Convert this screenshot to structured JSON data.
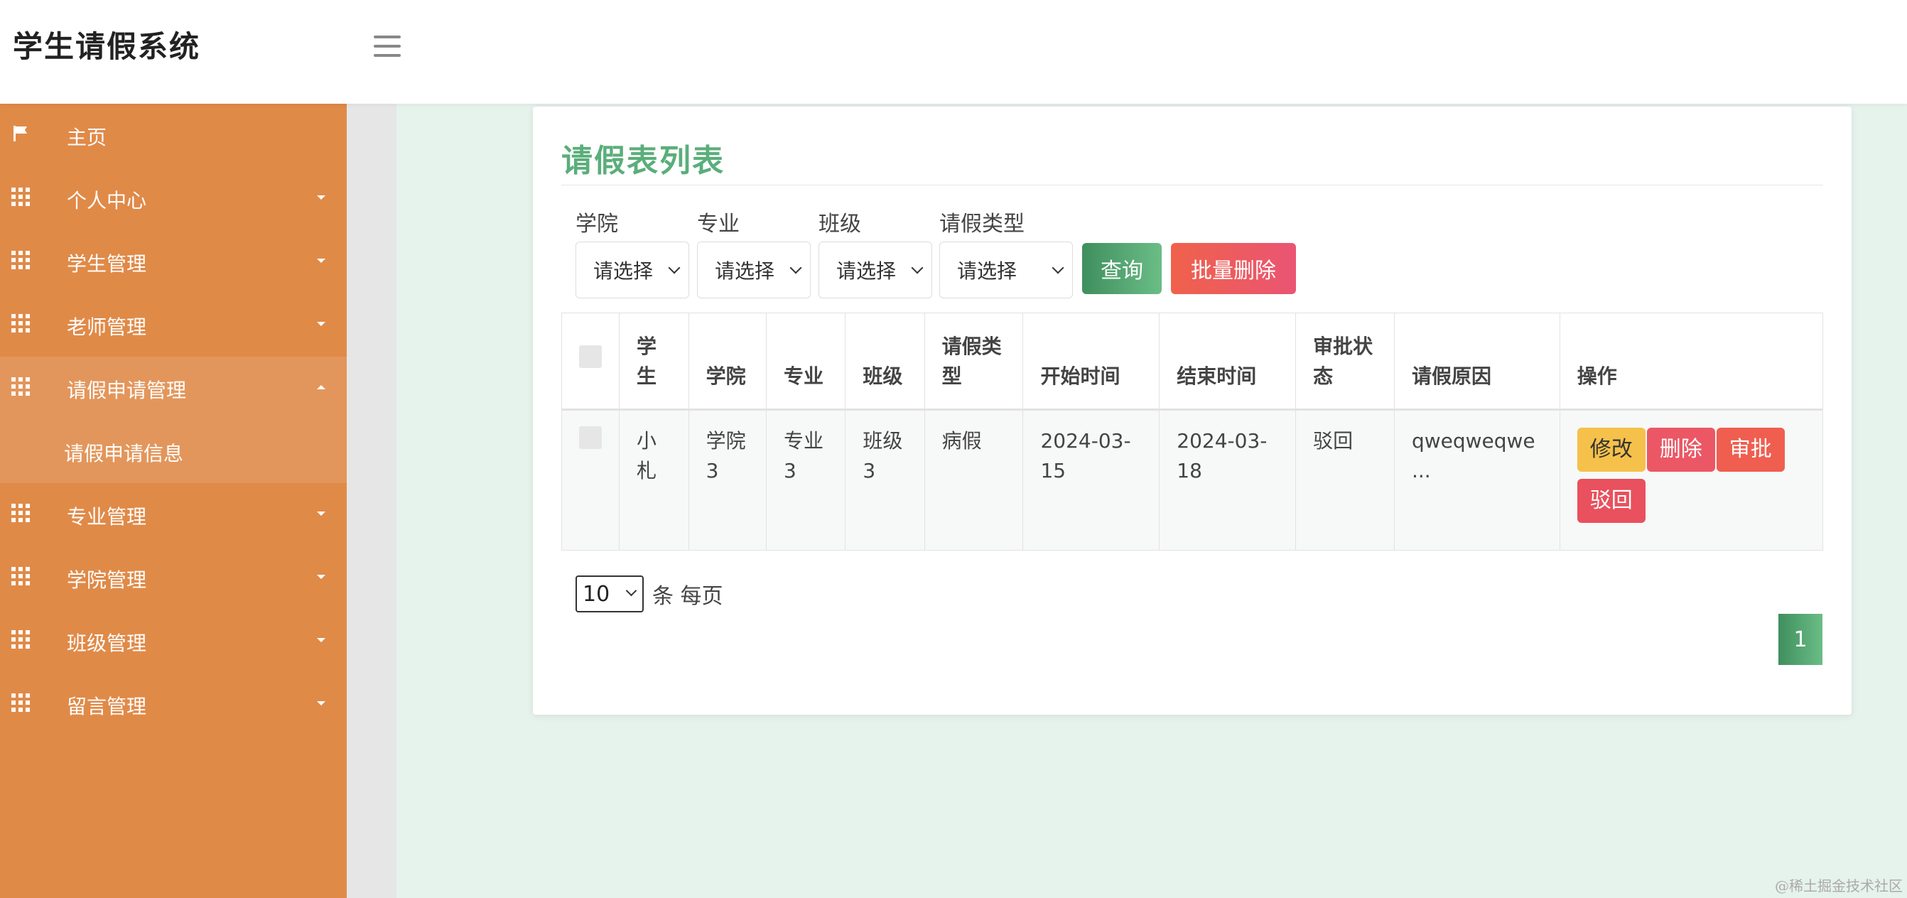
{
  "header": {
    "brand": "学生请假系统",
    "menu_icon": "hamburger-icon"
  },
  "sidebar": {
    "items": [
      {
        "label": "主页",
        "icon": "flag-icon"
      },
      {
        "label": "个人中心",
        "icon": "grid-icon"
      },
      {
        "label": "学生管理",
        "icon": "grid-icon"
      },
      {
        "label": "老师管理",
        "icon": "grid-icon"
      },
      {
        "label": "请假申请管理",
        "icon": "grid-icon",
        "expanded": true,
        "sub": "请假申请信息"
      },
      {
        "label": "专业管理",
        "icon": "grid-icon"
      },
      {
        "label": "学院管理",
        "icon": "grid-icon"
      },
      {
        "label": "班级管理",
        "icon": "grid-icon"
      },
      {
        "label": "留言管理",
        "icon": "grid-icon"
      }
    ]
  },
  "panel": {
    "title": "请假表列表"
  },
  "filters": [
    {
      "label": "学院",
      "value": "请选择"
    },
    {
      "label": "专业",
      "value": "请选择"
    },
    {
      "label": "班级",
      "value": "请选择"
    },
    {
      "label": "请假类型",
      "value": "请选择"
    }
  ],
  "buttons": {
    "query": "查询",
    "batch_delete": "批量删除"
  },
  "table": {
    "headers": [
      "学生",
      "学院",
      "专业",
      "班级",
      "请假类型",
      "开始时间",
      "结束时间",
      "审批状态",
      "请假原因",
      "操作"
    ],
    "rows": [
      {
        "student": "小札",
        "college": "学院3",
        "major": "专业3",
        "class": "班级3",
        "type": "病假",
        "start": "2024-03-15",
        "end": "2024-03-18",
        "status": "驳回",
        "reason": "qweqweqwe ..."
      }
    ],
    "actions": {
      "edit": "修改",
      "delete": "删除",
      "approve": "审批",
      "reject": "驳回"
    }
  },
  "pager": {
    "size": "10",
    "per_page": "条 每页",
    "current_page": "1"
  },
  "watermark": "@稀土掘金技术社区",
  "colors": {
    "sidebar": "#e08a48",
    "title": "#5aae7a",
    "accent_green": "#4a9d6a",
    "danger": "#ec5765",
    "warning": "#f5c14a"
  }
}
